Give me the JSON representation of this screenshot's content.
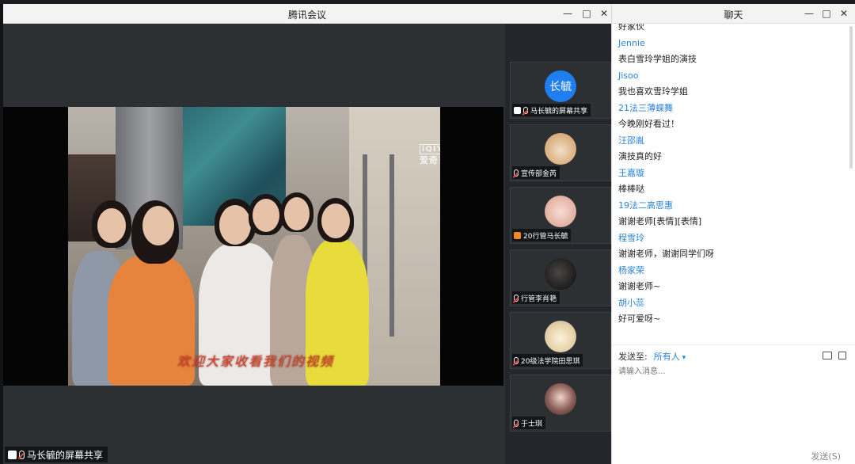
{
  "meeting": {
    "title": "腾讯会议",
    "share_label": "马长毓的屏幕共享",
    "watermark": "爱奇艺",
    "watermark_logo": "iQIYI",
    "subtitle": "欢迎大家收看我们的视频"
  },
  "participants": [
    {
      "name": "马长毓的屏幕共享",
      "avatar_text": "长毓",
      "avatar_color": "#1f7ef0"
    },
    {
      "name": "宣传部金芮"
    },
    {
      "name": "20行管马长毓"
    },
    {
      "name": "行管李肖艳"
    },
    {
      "name": "20级法学院田思琪"
    },
    {
      "name": "于士琪"
    }
  ],
  "chat": {
    "title": "聊天",
    "messages": [
      {
        "name": "",
        "text": "好家伙"
      },
      {
        "name": "Jennie",
        "text": "表白雪玲学姐的演技"
      },
      {
        "name": "Jisoo",
        "text": "我也喜欢雪玲学姐"
      },
      {
        "name": "21法三薄蝶舞",
        "text": "今晚刚好看过！"
      },
      {
        "name": "汪邵胤",
        "text": "演技真的好"
      },
      {
        "name": "王嘉璇",
        "text": "棒棒哒"
      },
      {
        "name": "19法二高思惠",
        "text": "谢谢老师[表情][表情]"
      },
      {
        "name": "程雪玲",
        "text": "谢谢老师，谢谢同学们呀"
      },
      {
        "name": "杨家荣",
        "text": "谢谢老师~"
      },
      {
        "name": "胡小蕊",
        "text": "好可爱呀~"
      }
    ],
    "send_to_label": "发送至:",
    "recipient": "所有人",
    "input_placeholder": "请输入消息...",
    "send_label": "发送(S)"
  },
  "colors": {
    "accent": "#2b84d9",
    "mic_muted": "#e4473d"
  }
}
